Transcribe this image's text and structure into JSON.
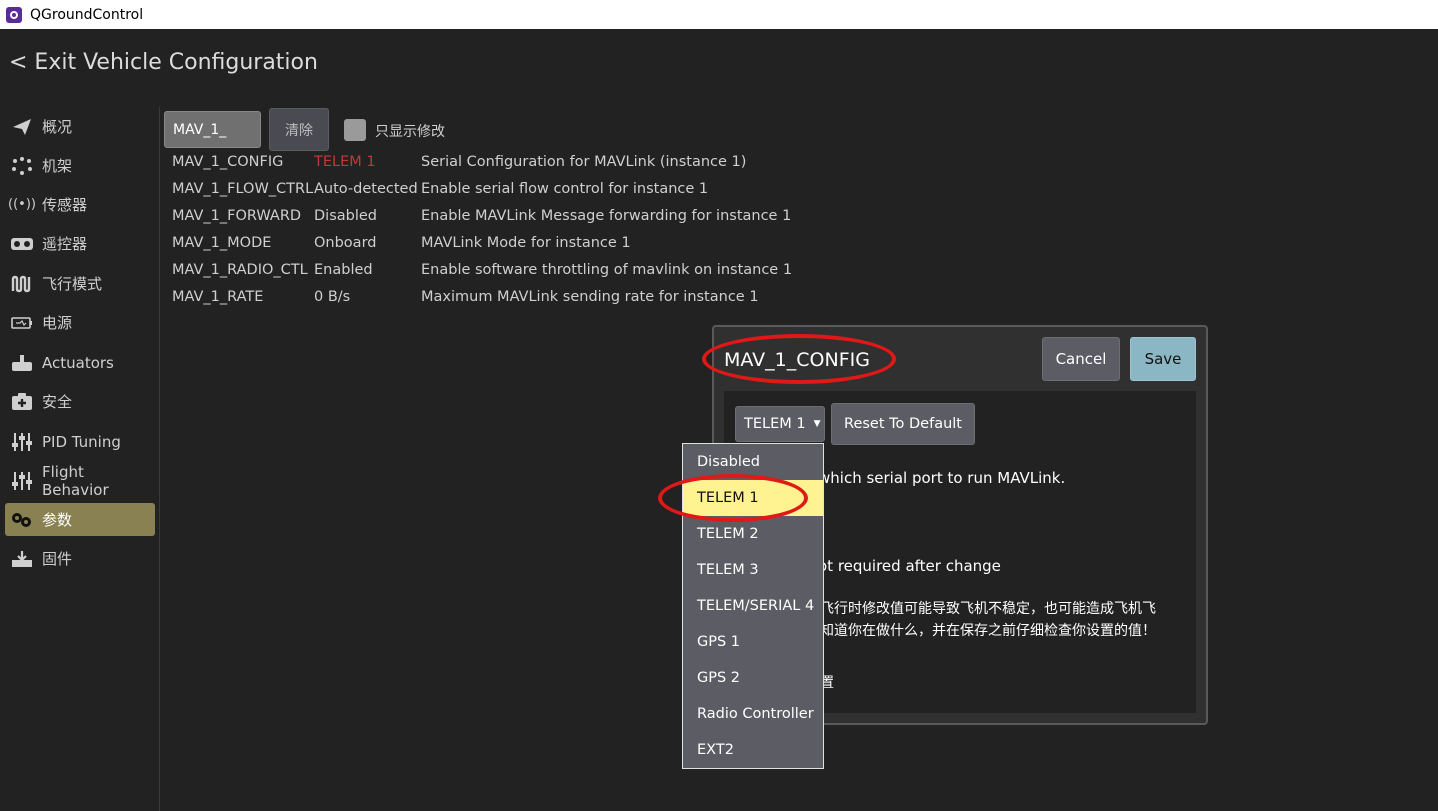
{
  "window": {
    "title": "QGroundControl"
  },
  "header": {
    "exit_label": "< Exit Vehicle Configuration"
  },
  "sidebar": {
    "items": [
      {
        "label": "概况",
        "icon": "paper-plane-icon"
      },
      {
        "label": "机架",
        "icon": "frame-icon"
      },
      {
        "label": "传感器",
        "icon": "sensor-icon"
      },
      {
        "label": "遥控器",
        "icon": "radio-icon"
      },
      {
        "label": "飞行模式",
        "icon": "flight-modes-icon"
      },
      {
        "label": "电源",
        "icon": "battery-icon"
      },
      {
        "label": "Actuators",
        "icon": "actuator-icon"
      },
      {
        "label": "安全",
        "icon": "safety-icon"
      },
      {
        "label": "PID Tuning",
        "icon": "sliders-icon"
      },
      {
        "label": "Flight Behavior",
        "icon": "sliders-icon"
      },
      {
        "label": "参数",
        "icon": "gears-icon",
        "active": true
      },
      {
        "label": "固件",
        "icon": "firmware-icon"
      }
    ]
  },
  "filter": {
    "search_value": "MAV_1_",
    "clear_label": "清除",
    "modified_only_label": "只显示修改"
  },
  "params": [
    {
      "name": "MAV_1_CONFIG",
      "value": "TELEM 1",
      "desc": "Serial Configuration for MAVLink (instance 1)",
      "changed": true
    },
    {
      "name": "MAV_1_FLOW_CTRL",
      "value": "Auto-detected",
      "desc": "Enable serial flow control for instance 1"
    },
    {
      "name": "MAV_1_FORWARD",
      "value": "Disabled",
      "desc": "Enable MAVLink Message forwarding for instance 1"
    },
    {
      "name": "MAV_1_MODE",
      "value": "Onboard",
      "desc": "MAVLink Mode for instance 1"
    },
    {
      "name": "MAV_1_RADIO_CTL",
      "value": "Enabled",
      "desc": "Enable software throttling of mavlink on instance 1"
    },
    {
      "name": "MAV_1_RATE",
      "value": "0 B/s",
      "desc": "Maximum MAVLink sending rate for instance 1"
    }
  ],
  "dialog": {
    "title": "MAV_1_CONFIG",
    "cancel_label": "Cancel",
    "save_label": "Save",
    "current_value": "TELEM 1",
    "reset_label": "Reset To Default",
    "desc_partial": "which serial port to run MAVLink.",
    "reboot_partial": "ot required after change",
    "warning_line1": "飞行时修改值可能导致飞机不稳定，也可能造成飞机飞",
    "warning_line2": "知道你在做什么，并在保存之前仔细检查你设置的值！",
    "advanced_partial": "置"
  },
  "dropdown": {
    "options": [
      "Disabled",
      "TELEM 1",
      "TELEM 2",
      "TELEM 3",
      "TELEM/SERIAL 4",
      "GPS 1",
      "GPS 2",
      "Radio Controller",
      "EXT2"
    ],
    "selected": "TELEM 1"
  },
  "colors": {
    "background": "#222222",
    "sidebar_active": "#8a8152",
    "changed_value": "#c23838",
    "save_button": "#8bb6c3",
    "dropdown_selected": "#fff291",
    "annotation": "#e01818"
  }
}
